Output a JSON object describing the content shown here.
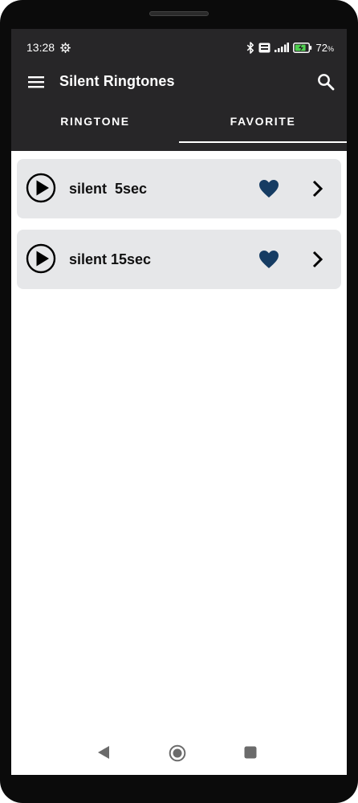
{
  "status_bar": {
    "time": "13:28",
    "battery_percent": "72",
    "battery_unit": "%",
    "icons": [
      "settings-gear-icon",
      "bluetooth-icon",
      "volte-icon",
      "signal-icon",
      "battery-charging-icon"
    ]
  },
  "app_bar": {
    "title": "Silent Ringtones",
    "menu_icon": "hamburger-menu-icon",
    "search_icon": "search-icon"
  },
  "tabs": [
    {
      "label": "RINGTONE",
      "active": false
    },
    {
      "label": "FAVORITE",
      "active": true
    }
  ],
  "favorites": [
    {
      "title": "silent  5sec",
      "favorited": true
    },
    {
      "title": "silent 15sec",
      "favorited": true
    }
  ],
  "colors": {
    "app_bar": "#272628",
    "list_item_bg": "#e6e7e9",
    "heart": "#163c63",
    "tab_indicator": "#ffffff"
  },
  "nav_bar": {
    "icons": [
      "back-icon",
      "home-icon",
      "recents-icon"
    ]
  }
}
